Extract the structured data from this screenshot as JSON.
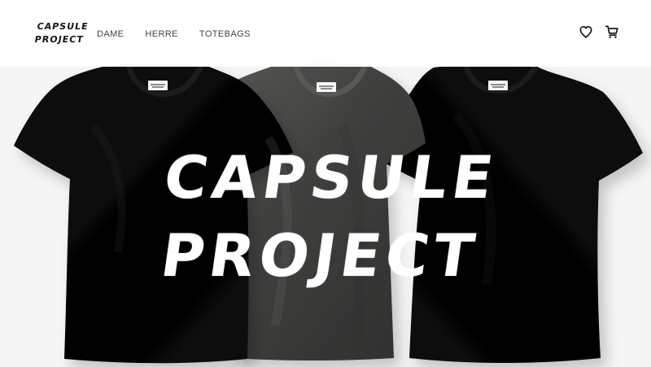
{
  "header": {
    "brand_line_1": "CAPSULE",
    "brand_line_2": "PROJECT",
    "nav": [
      {
        "label": "DAME"
      },
      {
        "label": "HERRE"
      },
      {
        "label": "TOTEBAGS"
      }
    ]
  },
  "hero": {
    "title_line_1": "CAPSULE",
    "title_line_2": "PROJECT"
  },
  "colors": {
    "text": "#141414",
    "nav_text": "#444444",
    "shirt_black": "#050505",
    "shirt_gray": "#3d3d3b",
    "hero_text": "#ffffff"
  },
  "icons": {
    "wishlist": "heart-icon",
    "cart": "shopping-cart-icon"
  }
}
